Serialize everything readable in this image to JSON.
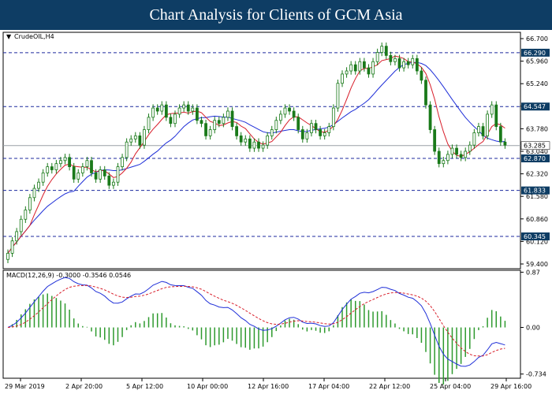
{
  "header": {
    "title": "Chart Analysis for Clients of GCM Asia"
  },
  "chart_data": [
    {
      "type": "candlestick",
      "symbol": "CrudeOIL,H4",
      "ylim": [
        59.3,
        66.95
      ],
      "y_ticks": [
        "66.700",
        "65.960",
        "65.240",
        "64.510",
        "63.780",
        "63.040",
        "62.320",
        "61.580",
        "60.860",
        "60.120",
        "59.400"
      ],
      "levels": [
        {
          "value": 66.29,
          "label": "66.290"
        },
        {
          "value": 64.547,
          "label": "64.547"
        },
        {
          "value": 62.87,
          "label": "62.870"
        },
        {
          "value": 61.833,
          "label": "61.833"
        },
        {
          "value": 60.345,
          "label": "60.345"
        }
      ],
      "current_price": {
        "value": 63.285,
        "label": "63.285"
      },
      "x_labels": [
        "29 Mar 2019",
        "2 Apr 20:00",
        "5 Apr 12:00",
        "10 Apr 00:00",
        "12 Apr 16:00",
        "17 Apr 04:00",
        "22 Apr 12:00",
        "25 Apr 04:00",
        "29 Apr 16:00"
      ],
      "ma_fast_color": "#d81e2a",
      "ma_slow_color": "#1f2fd8",
      "candle_color": "#1a7a1a",
      "level_color": "#1d2a9e",
      "close": [
        59.8,
        60.2,
        60.5,
        60.9,
        61.2,
        61.6,
        61.9,
        62.1,
        62.4,
        62.6,
        62.5,
        62.7,
        62.8,
        62.9,
        62.6,
        62.2,
        62.4,
        62.6,
        62.8,
        62.4,
        62.2,
        62.5,
        62.3,
        62.0,
        62.1,
        62.6,
        62.9,
        63.4,
        63.5,
        63.6,
        63.3,
        63.8,
        64.2,
        64.5,
        64.4,
        64.6,
        64.2,
        64.0,
        64.3,
        64.5,
        64.6,
        64.4,
        64.5,
        64.1,
        64.0,
        63.6,
        63.8,
        64.1,
        64.0,
        64.2,
        64.4,
        63.9,
        63.6,
        63.4,
        63.5,
        63.2,
        63.4,
        63.2,
        63.3,
        63.6,
        63.8,
        64.1,
        64.3,
        64.5,
        64.4,
        64.2,
        63.8,
        63.5,
        63.7,
        64.0,
        63.8,
        63.6,
        63.7,
        63.9,
        64.5,
        65.3,
        65.6,
        65.7,
        65.9,
        65.7,
        66.0,
        65.8,
        65.6,
        66.0,
        66.3,
        66.5,
        66.2,
        66.0,
        66.1,
        65.8,
        66.0,
        65.9,
        66.1,
        65.7,
        65.4,
        64.6,
        63.8,
        63.1,
        62.7,
        62.8,
        63.0,
        63.2,
        63.0,
        62.9,
        63.1,
        63.3,
        63.7,
        63.9,
        63.6,
        64.3,
        64.6,
        63.9,
        63.4,
        63.3
      ],
      "macd": {
        "label": "MACD(12,26,9) -0.3000 -0.3546 0.0546",
        "ylim": [
          -0.8,
          0.9
        ],
        "y_ticks": [
          "0.87",
          "0.00",
          "-0.734"
        ]
      }
    }
  ]
}
